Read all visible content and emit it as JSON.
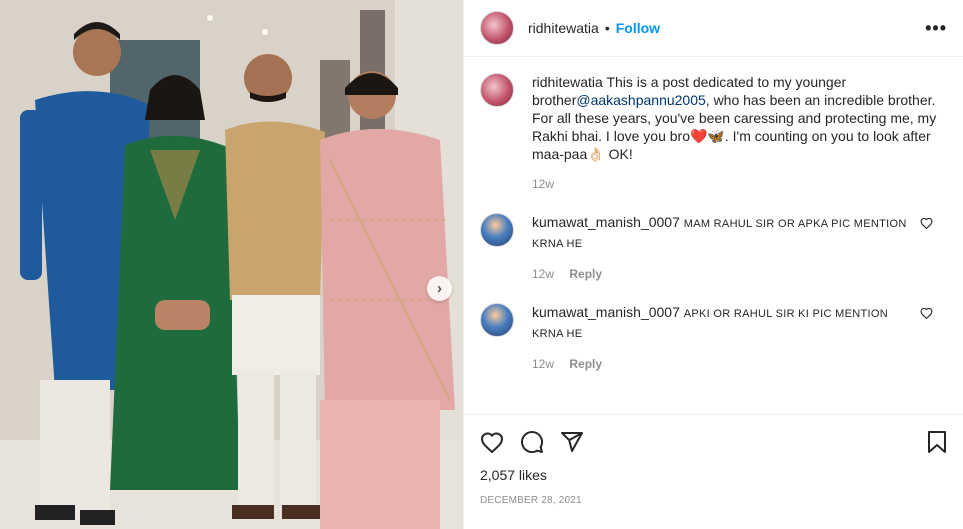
{
  "post": {
    "username": "ridhitewatia",
    "follow_label": "Follow",
    "separator": "•",
    "more_label": "•••",
    "caption": {
      "username": "ridhitewatia",
      "text_before_mention": "This is a post dedicated to my younger brother",
      "mention": "@aakashpannu2005",
      "text_after_mention": ", who has been an incredible brother. For all these years, you've been caressing and protecting me, my Rakhi bhai. I love you bro",
      "emoji_1": "❤️🦋",
      "text_after_emoji": ". I'm counting on you to look after maa-paa",
      "emoji_2": "👌🏻",
      "text_end": " OK!",
      "time": "12w"
    },
    "comments": [
      {
        "username": "kumawat_manish_0007",
        "text": "MAM RAHUL SIR OR APKA PIC MENTION KRNA HE",
        "time": "12w",
        "reply_label": "Reply"
      },
      {
        "username": "kumawat_manish_0007",
        "text": "APKI OR RAHUL SIR KI PIC MENTION KRNA HE",
        "time": "12w",
        "reply_label": "Reply"
      }
    ],
    "likes": "2,057 likes",
    "date": "DECEMBER 28, 2021",
    "next_label": "›"
  },
  "icons": {
    "like": "heart-icon",
    "comment": "comment-icon",
    "share": "share-icon",
    "save": "bookmark-icon",
    "more": "more-icon",
    "next": "chevron-right-icon"
  },
  "colors": {
    "follow": "#0095f6",
    "mention": "#00376b",
    "muted": "#8e8e8e",
    "text": "#262626",
    "border": "#efefef"
  }
}
